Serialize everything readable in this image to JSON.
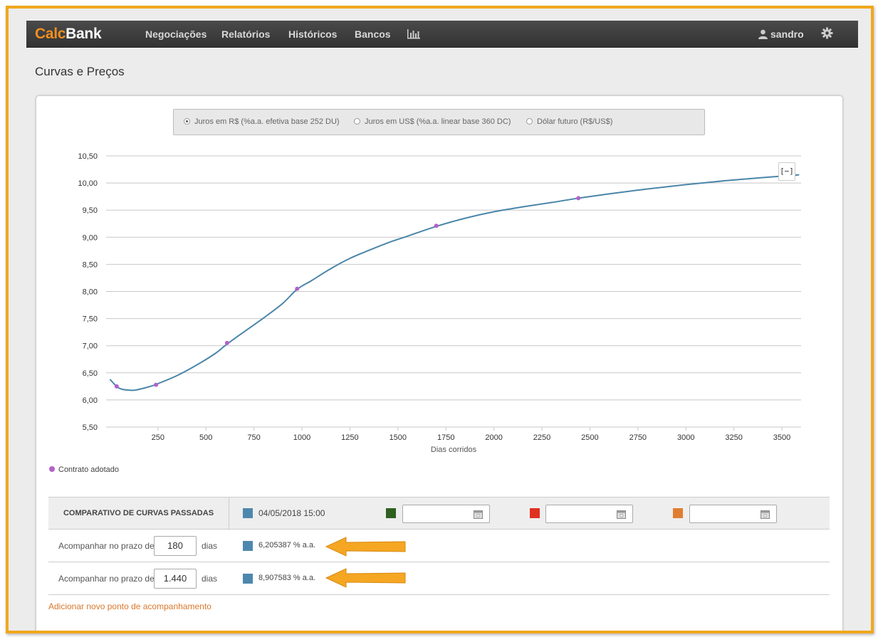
{
  "app": {
    "logo_part1": "Calc",
    "logo_part2": "Bank",
    "nav": [
      "Negociações",
      "Relatórios",
      "Históricos",
      "Bancos"
    ],
    "nav_chart_icon": "bar-chart-icon",
    "user_name": "sandro",
    "user_icon": "user-icon",
    "settings_icon": "gear-icon"
  },
  "page": {
    "title": "Curvas e Preços"
  },
  "curve_type": {
    "options": [
      {
        "label": "Juros em R$ (%a.a. efetiva base 252 DU)",
        "selected": true
      },
      {
        "label": "Juros em US$ (%a.a. linear base 360 DC)",
        "selected": false
      },
      {
        "label": "Dólar futuro (R$/US$)",
        "selected": false
      }
    ]
  },
  "chart_data": {
    "type": "line",
    "xlabel": "Dias corridos",
    "ylabel": "",
    "xlim": [
      -20,
      3600
    ],
    "ylim": [
      5.5,
      10.5
    ],
    "x_ticks": [
      250,
      500,
      750,
      1000,
      1250,
      1500,
      1750,
      2000,
      2250,
      2500,
      2750,
      3000,
      3250,
      3500
    ],
    "y_ticks": [
      5.5,
      6.0,
      6.5,
      7.0,
      7.5,
      8.0,
      8.5,
      9.0,
      9.5,
      10.0,
      10.5
    ],
    "y_tick_labels": [
      "5,50",
      "6,00",
      "6,50",
      "7,00",
      "7,50",
      "8,00",
      "8,50",
      "9,00",
      "9,50",
      "10,00",
      "10,50"
    ],
    "grid": true,
    "series": [
      {
        "values": [
          [
            0,
            6.38
          ],
          [
            35,
            6.25
          ],
          [
            60,
            6.2
          ],
          [
            100,
            6.18
          ],
          [
            130,
            6.18
          ],
          [
            180,
            6.22
          ],
          [
            220,
            6.26
          ],
          [
            250,
            6.3
          ],
          [
            350,
            6.45
          ],
          [
            450,
            6.64
          ],
          [
            550,
            6.86
          ],
          [
            610,
            7.03
          ],
          [
            700,
            7.26
          ],
          [
            800,
            7.51
          ],
          [
            900,
            7.78
          ],
          [
            975,
            8.04
          ],
          [
            1050,
            8.2
          ],
          [
            1150,
            8.42
          ],
          [
            1250,
            8.61
          ],
          [
            1350,
            8.76
          ],
          [
            1450,
            8.9
          ],
          [
            1550,
            9.02
          ],
          [
            1700,
            9.2
          ],
          [
            1850,
            9.35
          ],
          [
            2000,
            9.47
          ],
          [
            2150,
            9.56
          ],
          [
            2300,
            9.64
          ],
          [
            2440,
            9.72
          ],
          [
            2600,
            9.8
          ],
          [
            2800,
            9.89
          ],
          [
            3000,
            9.97
          ],
          [
            3200,
            10.04
          ],
          [
            3400,
            10.1
          ],
          [
            3590,
            10.15
          ]
        ]
      }
    ],
    "points": {
      "name": "Contrato adotado",
      "color": "#b361c8",
      "values": [
        [
          35,
          6.25
        ],
        [
          240,
          6.28
        ],
        [
          610,
          7.05
        ],
        [
          975,
          8.05
        ],
        [
          1700,
          9.21
        ],
        [
          2440,
          9.72
        ]
      ]
    },
    "line_color": "#4a86a9",
    "reset_label": "[−]"
  },
  "legend": {
    "label": "Contrato adotado"
  },
  "compare": {
    "title": "COMPARATIVO DE CURVAS PASSADAS",
    "date1": "04/05/2018 15:00",
    "colors": [
      "#4e87ad",
      "#2e6020",
      "#e03020",
      "#e07d30"
    ],
    "date_inputs": [
      "",
      "",
      ""
    ],
    "rows": [
      {
        "label": "Acompanhar no prazo de",
        "days": "180",
        "unit": "dias",
        "value": "6,205387 % a.a."
      },
      {
        "label": "Acompanhar no prazo de",
        "days": "1.440",
        "unit": "dias",
        "value": "8,907583 % a.a."
      }
    ],
    "add_link": "Adicionar novo ponto de acompanhamento",
    "highlight_color": "#f5a623"
  }
}
